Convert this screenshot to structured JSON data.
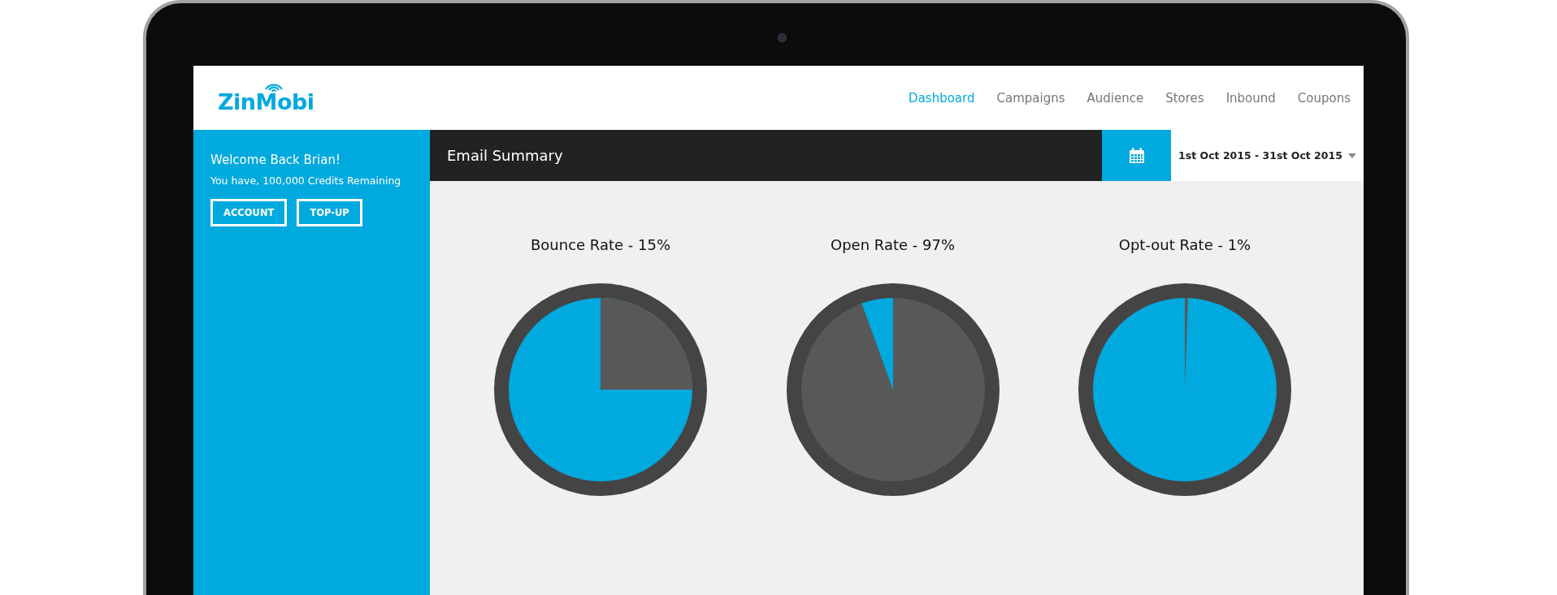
{
  "brand": {
    "name": "ZinMobi"
  },
  "nav": [
    {
      "label": "Dashboard",
      "selected": true
    },
    {
      "label": "Campaigns",
      "selected": false
    },
    {
      "label": "Audience",
      "selected": false
    },
    {
      "label": "Stores",
      "selected": false
    },
    {
      "label": "Inbound",
      "selected": false
    },
    {
      "label": "Coupons",
      "selected": false
    }
  ],
  "sidebar": {
    "welcome": "Welcome Back Brian!",
    "credits": "You have, 100,000 Credits Remaining",
    "buttons": [
      "ACCOUNT",
      "TOP-UP"
    ]
  },
  "summary": {
    "title": "Email Summary",
    "date_range": "1st Oct 2015 - 31st Oct 2015"
  },
  "charts": [
    {
      "title": "Bounce Rate - 15%"
    },
    {
      "title": "Open Rate - 97%"
    },
    {
      "title": "Opt-out Rate - 1%"
    }
  ]
}
